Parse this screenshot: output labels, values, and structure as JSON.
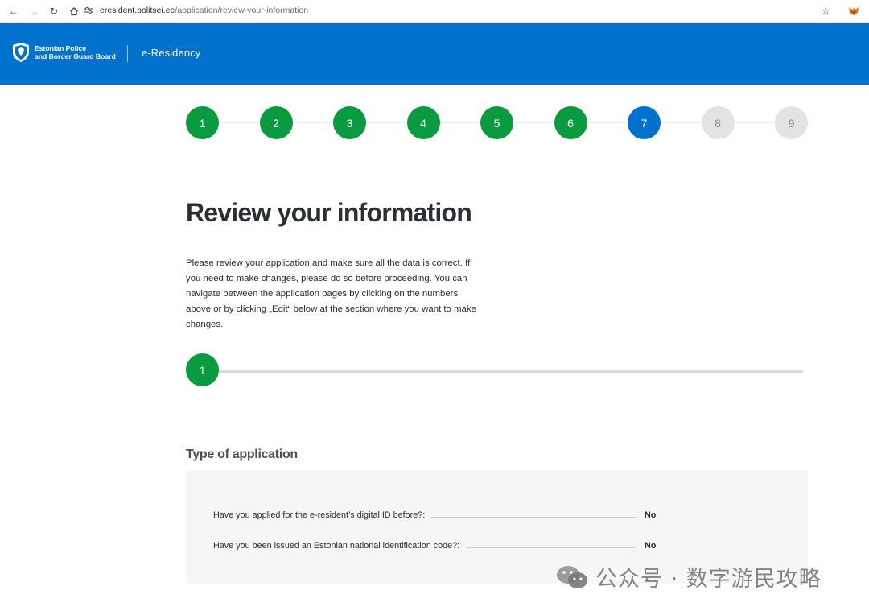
{
  "browser": {
    "url_host": "eresident.politsei.ee",
    "url_path": "/application/review-your-information",
    "icons": [
      "back-icon",
      "forward-icon",
      "reload-icon",
      "home-icon",
      "site-settings-icon",
      "bookmark-star-icon",
      "extension-icon"
    ]
  },
  "header": {
    "org_line1": "Estonian Police",
    "org_line2": "and Border Guard Board",
    "product": "e-Residency",
    "bg_color": "#0072ce"
  },
  "stepper": {
    "steps": [
      {
        "label": "1",
        "state": "done"
      },
      {
        "label": "2",
        "state": "done"
      },
      {
        "label": "3",
        "state": "done"
      },
      {
        "label": "4",
        "state": "done"
      },
      {
        "label": "5",
        "state": "done"
      },
      {
        "label": "6",
        "state": "done"
      },
      {
        "label": "7",
        "state": "current"
      },
      {
        "label": "8",
        "state": "todo"
      },
      {
        "label": "9",
        "state": "todo"
      }
    ],
    "colors": {
      "done": "#0a9a3f",
      "current": "#0072ce",
      "todo": "#e3e3e3"
    }
  },
  "main": {
    "title": "Review your information",
    "intro": "Please review your application and make sure all the data is correct. If you need to make changes, please do so before proceeding. You can navigate between the application pages by clicking on the numbers above or by clicking „Edit“ below at the section where you want to make changes.",
    "section_number": "1",
    "section_title": "Type of application",
    "rows": [
      {
        "question": "Have you applied for the e-resident’s digital ID before?:",
        "answer": "No"
      },
      {
        "question": "Have you been issued an Estonian national identification code?:",
        "answer": "No"
      }
    ]
  },
  "watermark": {
    "text": "公众号 · 数字游民攻略"
  }
}
